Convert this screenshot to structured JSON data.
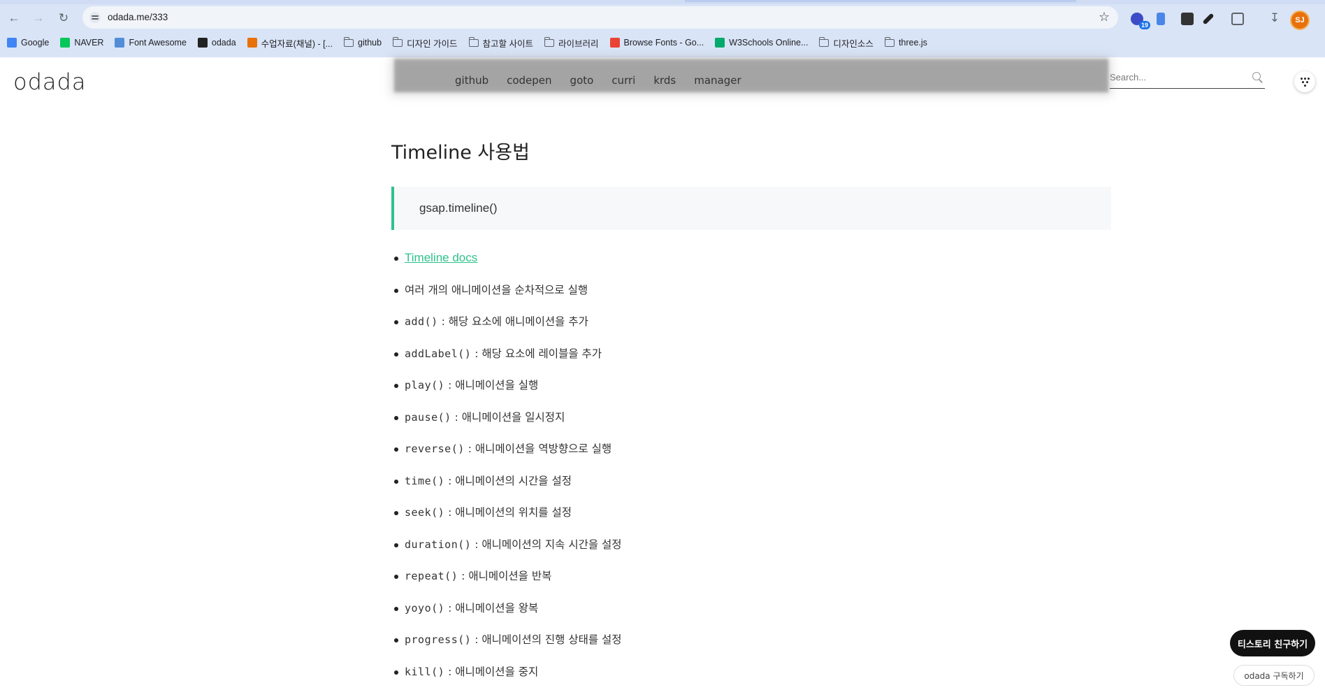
{
  "browser": {
    "url": "odada.me/333",
    "extension_badge": "19",
    "profile_initials": "SJ",
    "bookmarks": [
      {
        "label": "Google",
        "icon": "google-icon"
      },
      {
        "label": "NAVER",
        "icon": "naver-icon"
      },
      {
        "label": "Font Awesome",
        "icon": "flag-icon"
      },
      {
        "label": "odada",
        "icon": "odada-icon"
      },
      {
        "label": "수업자료(채널) - [...",
        "icon": "app-icon"
      },
      {
        "label": "github",
        "icon": "folder-icon"
      },
      {
        "label": "디자인 가이드",
        "icon": "folder-icon"
      },
      {
        "label": "참고할 사이트",
        "icon": "folder-icon"
      },
      {
        "label": "라이브러리",
        "icon": "folder-icon"
      },
      {
        "label": "Browse Fonts - Go...",
        "icon": "fonts-icon"
      },
      {
        "label": "W3Schools Online...",
        "icon": "w3schools-icon"
      },
      {
        "label": "디자인소스",
        "icon": "folder-icon"
      },
      {
        "label": "three.js",
        "icon": "folder-icon"
      }
    ]
  },
  "site": {
    "logo": "odada",
    "nav": [
      "github",
      "codepen",
      "goto",
      "curri",
      "krds",
      "manager"
    ],
    "search_placeholder": "Search..."
  },
  "post": {
    "title": "Timeline 사용법",
    "code_quote": "gsap.timeline()",
    "docs_link": "Timeline docs",
    "items": [
      {
        "code": "",
        "desc": "여러 개의 애니메이션을 순차적으로 실행"
      },
      {
        "code": "add()",
        "desc": " : 해당 요소에 애니메이션을 추가"
      },
      {
        "code": "addLabel()",
        "desc": " : 해당 요소에 레이블을 추가"
      },
      {
        "code": "play()",
        "desc": " : 애니메이션을 실행"
      },
      {
        "code": "pause()",
        "desc": " : 애니메이션을 일시정지"
      },
      {
        "code": "reverse()",
        "desc": " : 애니메이션을 역방향으로 실행"
      },
      {
        "code": "time()",
        "desc": " : 애니메이션의 시간을 설정"
      },
      {
        "code": "seek()",
        "desc": " : 애니메이션의 위치를 설정"
      },
      {
        "code": "duration()",
        "desc": " : 애니메이션의 지속 시간을 설정"
      },
      {
        "code": "repeat()",
        "desc": " : 애니메이션을 반복"
      },
      {
        "code": "yoyo()",
        "desc": " : 애니메이션을 왕복"
      },
      {
        "code": "progress()",
        "desc": " : 애니메이션의 진행 상태를 설정"
      },
      {
        "code": "kill()",
        "desc": " : 애니메이션을 중지"
      }
    ]
  },
  "floating": {
    "friend_label": "티스토리 친구하기",
    "subscribe_label": "odada 구독하기"
  },
  "colors": {
    "accent": "#2fc28e",
    "chrome": "#d9e4f7"
  }
}
